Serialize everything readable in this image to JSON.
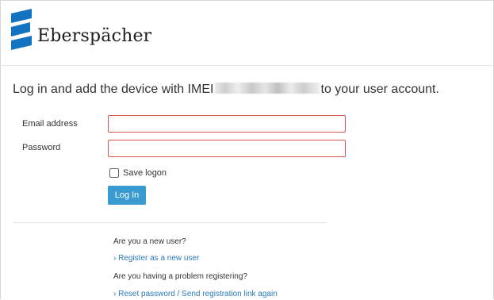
{
  "brand": {
    "name": "Eberspächer",
    "colors": {
      "accent": "#3a9bd1",
      "error_border": "#d9534f",
      "logo": "#1473c0"
    }
  },
  "heading": {
    "prefix": "Log in and add the device with IMEI",
    "suffix": "to your user account."
  },
  "form": {
    "email_label": "Email address",
    "email_value": "",
    "password_label": "Password",
    "password_value": "",
    "save_logon_label": "Save logon",
    "login_button": "Log In"
  },
  "help": {
    "new_user_question": "Are you a new user?",
    "register_link": "› Register as a new user",
    "problem_question": "Are you having a problem registering?",
    "reset_link": "› Reset password / Send registration link again"
  }
}
